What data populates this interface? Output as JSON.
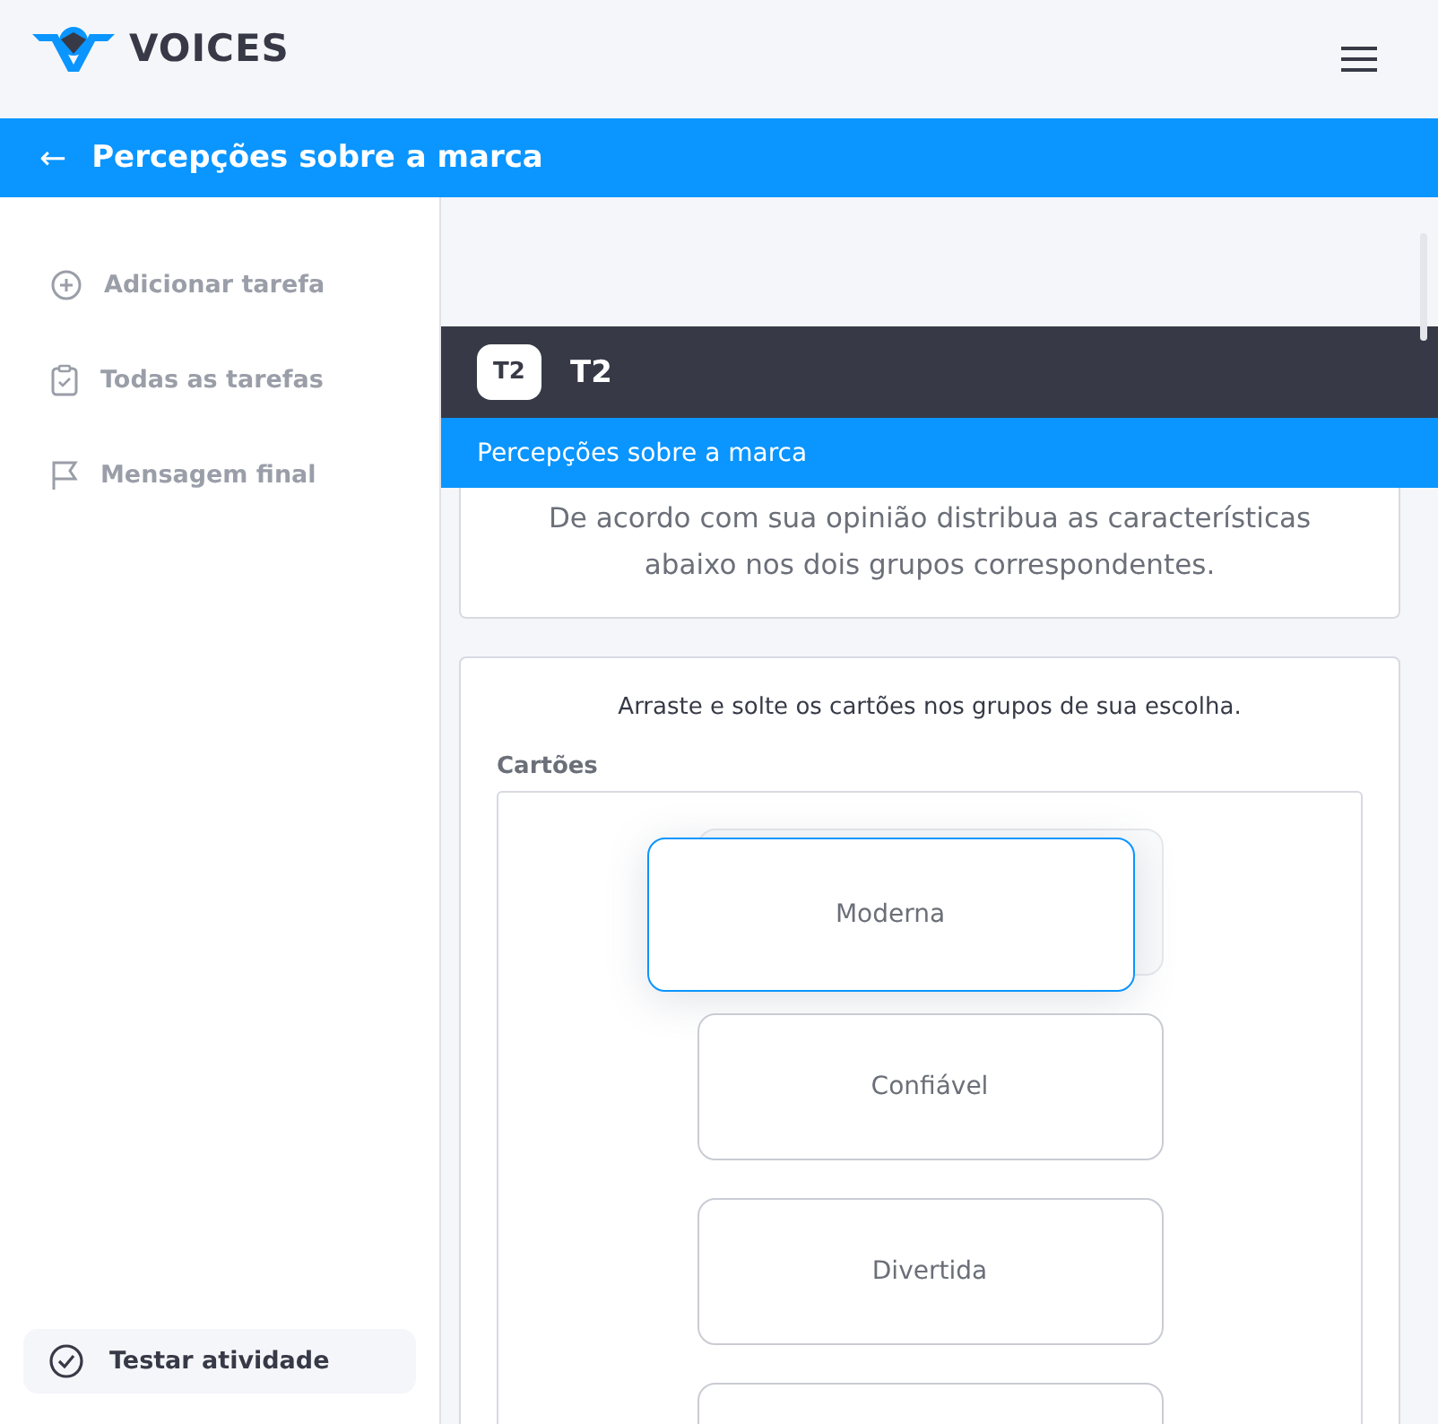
{
  "header": {
    "brand": "VOICES"
  },
  "title_bar": {
    "back_icon": "←",
    "title": "Percepções sobre a marca"
  },
  "sidebar": {
    "items": [
      {
        "kind": "add",
        "label": "Adicionar tarefa"
      },
      {
        "kind": "tasks",
        "label": "Todas as tarefas"
      },
      {
        "kind": "final",
        "label": "Mensagem final"
      }
    ],
    "test_button": "Testar atividade"
  },
  "task": {
    "badge": "T2",
    "name": "T2",
    "subtitle": "Percepções sobre a marca",
    "instruction": "De acordo com sua opinião distribua as características abaixo nos dois grupos correspondentes."
  },
  "board": {
    "hint": "Arraste e solte os cartões nos grupos de sua escolha.",
    "group_label": "Cartões",
    "cards": [
      {
        "label": "Moderna",
        "dragging": true
      },
      {
        "label": "Confiável",
        "dragging": false
      },
      {
        "label": "Divertida",
        "dragging": false
      },
      {
        "dragging": false
      }
    ]
  }
}
